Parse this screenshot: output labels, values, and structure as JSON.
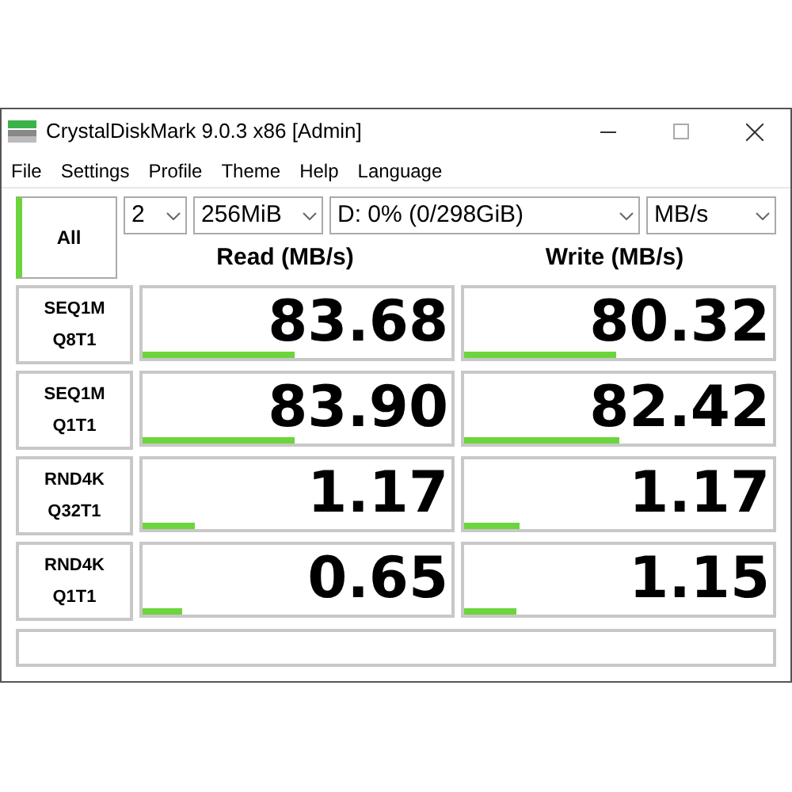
{
  "window": {
    "title": "CrystalDiskMark 9.0.3 x86 [Admin]"
  },
  "menu": [
    "File",
    "Settings",
    "Profile",
    "Theme",
    "Help",
    "Language"
  ],
  "all_button": "All",
  "selects": [
    {
      "value": "2",
      "kind": "small"
    },
    {
      "value": "256MiB",
      "kind": "medium"
    },
    {
      "value": "D: 0% (0/298GiB)",
      "kind": "wide"
    },
    {
      "value": "MB/s",
      "kind": "medium"
    }
  ],
  "headers": [
    "Read (MB/s)",
    "Write (MB/s)"
  ],
  "rows": [
    {
      "label": [
        "SEQ1M",
        "Q8T1"
      ],
      "read": {
        "value": "83.68",
        "level": 0.49
      },
      "write": {
        "value": "80.32",
        "level": 0.49
      }
    },
    {
      "label": [
        "SEQ1M",
        "Q1T1"
      ],
      "read": {
        "value": "83.90",
        "level": 0.49
      },
      "write": {
        "value": "82.42",
        "level": 0.5
      }
    },
    {
      "label": [
        "RND4K",
        "Q32T1"
      ],
      "read": {
        "value": "1.17",
        "level": 0.17
      },
      "write": {
        "value": "1.17",
        "level": 0.18
      }
    },
    {
      "label": [
        "RND4K",
        "Q1T1"
      ],
      "read": {
        "value": "0.65",
        "level": 0.13
      },
      "write": {
        "value": "1.15",
        "level": 0.17
      }
    }
  ]
}
